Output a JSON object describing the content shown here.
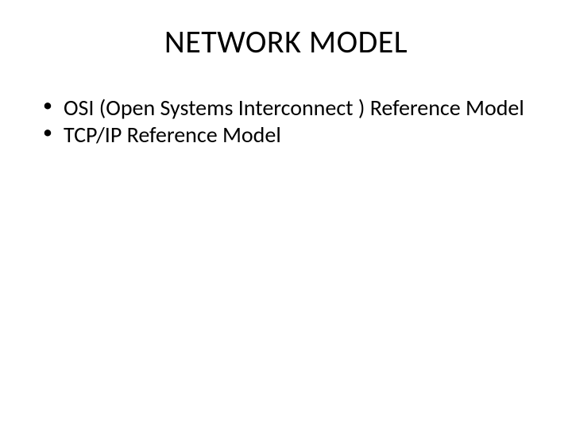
{
  "slide": {
    "title": "NETWORK MODEL",
    "bullets": [
      "OSI (Open Systems Interconnect ) Reference Model",
      "TCP/IP Reference Model"
    ]
  }
}
